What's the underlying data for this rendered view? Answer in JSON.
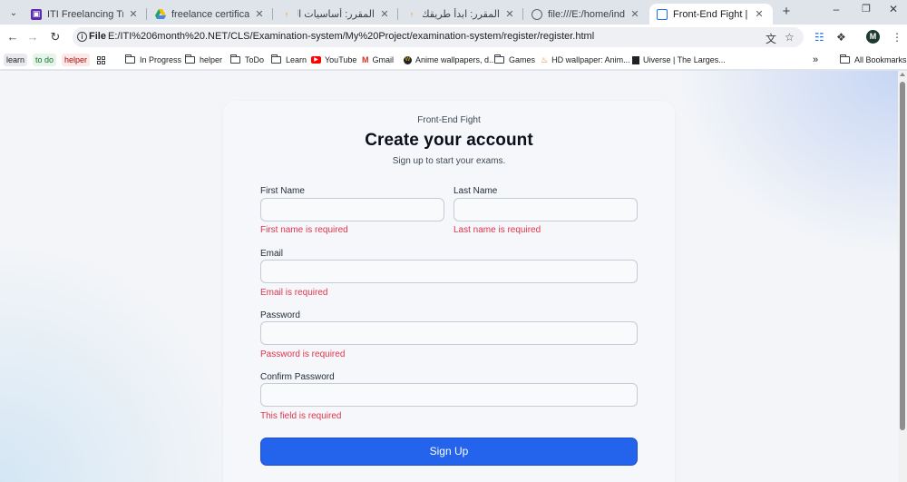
{
  "tabs": [
    {
      "title": "ITI Freelancing Trainees Inf",
      "icon": "iti-logo-icon"
    },
    {
      "title": "freelance certificates - Goo",
      "icon": "google-drive-icon"
    },
    {
      "title": "المقرر: أساسيات العمل الحر",
      "icon": "course-icon"
    },
    {
      "title": "المقرر: ابدأ طريقك في العمل",
      "icon": "course-icon"
    },
    {
      "title": "file:///E:/home/index.html",
      "icon": "globe-icon"
    },
    {
      "title": "Front-End Fight | Sign Up",
      "icon": "page-icon"
    }
  ],
  "toolbar": {
    "scheme": "File",
    "url": "E:/ITI%206month%20.NET/CLS/Examination-system/My%20Project/examination-system/register/register.html",
    "profile_initial": "M"
  },
  "bookmarks": {
    "chips": [
      "learn",
      "to do",
      "helper"
    ],
    "items": [
      "In Progress",
      "helper",
      "ToDo",
      "Learn",
      "YouTube",
      "Gmail",
      "Anime wallpapers, d...",
      "Games",
      "HD wallpaper: Anim...",
      "Uiverse | The Larges..."
    ],
    "overflow": "»",
    "all_bookmarks": "All Bookmarks"
  },
  "colors": {
    "accent": "#2463eb",
    "error": "#e0344c"
  },
  "form": {
    "brand": "Front-End Fight",
    "title": "Create your account",
    "subtitle": "Sign up to start your exams.",
    "first_name": {
      "label": "First Name",
      "value": "",
      "error": "First name is required"
    },
    "last_name": {
      "label": "Last Name",
      "value": "",
      "error": "Last name is required"
    },
    "email": {
      "label": "Email",
      "value": "",
      "error": "Email is required"
    },
    "password": {
      "label": "Password",
      "value": "",
      "error": "Password is required"
    },
    "confirm_password": {
      "label": "Confirm Password",
      "value": "",
      "error": "This field is required"
    },
    "submit": "Sign Up"
  }
}
